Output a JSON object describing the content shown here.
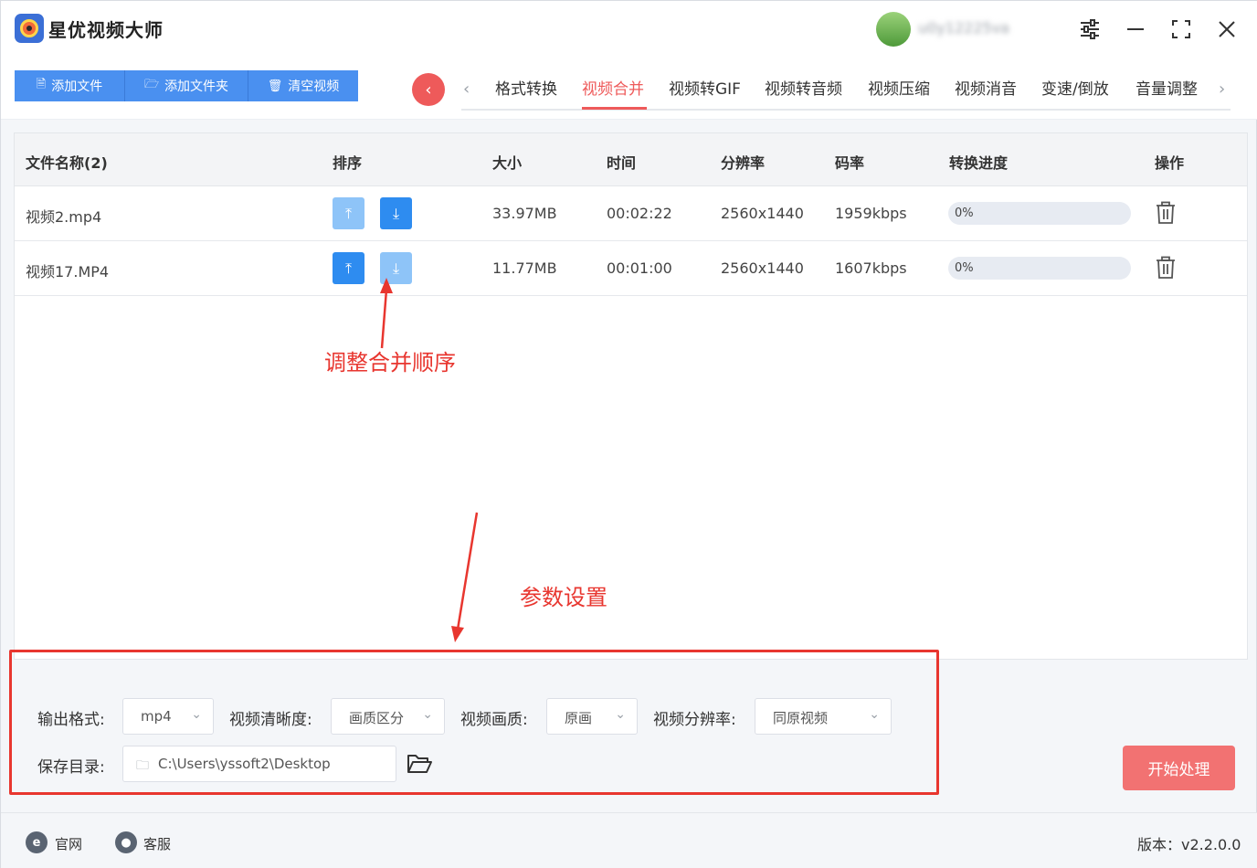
{
  "app": {
    "title": "星优视频大师",
    "username": "u0y12225va"
  },
  "toolbar": {
    "add_file": "添加文件",
    "add_folder": "添加文件夹",
    "clear_videos": "清空视频"
  },
  "tabs": [
    {
      "label": "格式转换"
    },
    {
      "label": "视频合并"
    },
    {
      "label": "视频转GIF"
    },
    {
      "label": "视频转音频"
    },
    {
      "label": "视频压缩"
    },
    {
      "label": "视频消音"
    },
    {
      "label": "变速/倒放"
    },
    {
      "label": "音量调整"
    }
  ],
  "active_tab": "视频合并",
  "table": {
    "headers": {
      "name": "文件名称(2)",
      "sort": "排序",
      "size": "大小",
      "time": "时间",
      "resolution": "分辨率",
      "bitrate": "码率",
      "progress": "转换进度",
      "action": "操作"
    },
    "rows": [
      {
        "name": "视频2.mp4",
        "size": "33.97MB",
        "time": "00:02:22",
        "resolution": "2560x1440",
        "bitrate": "1959kbps",
        "progress": "0%",
        "progress_value": 0
      },
      {
        "name": "视频17.MP4",
        "size": "11.77MB",
        "time": "00:01:00",
        "resolution": "2560x1440",
        "bitrate": "1607kbps",
        "progress": "0%",
        "progress_value": 0
      }
    ]
  },
  "annotations": {
    "sort_hint": "调整合并顺序",
    "params_hint": "参数设置"
  },
  "settings": {
    "output_format_label": "输出格式:",
    "output_format_value": "mp4",
    "clarity_label": "视频清晰度:",
    "clarity_value": "画质区分",
    "quality_label": "视频画质:",
    "quality_value": "原画",
    "resolution_label": "视频分辨率:",
    "resolution_value": "同原视频",
    "save_dir_label": "保存目录:",
    "save_dir_value": "C:\\Users\\yssoft2\\Desktop",
    "start_button": "开始处理"
  },
  "footer": {
    "website": "官网",
    "support": "客服",
    "version": "版本：v2.2.0.0"
  },
  "colors": {
    "accent_red": "#ee5a5a",
    "primary_blue": "#4a90f0",
    "annotation_red": "#e8362f"
  }
}
